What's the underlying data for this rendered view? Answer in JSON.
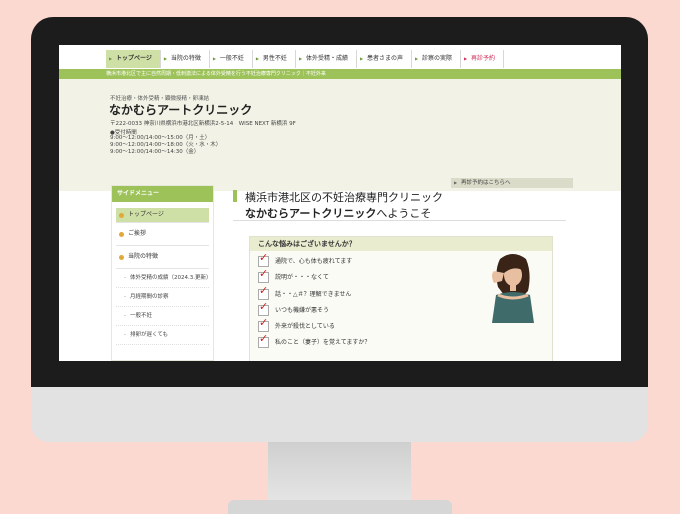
{
  "nav": {
    "items": [
      {
        "label": "トップページ"
      },
      {
        "label": "当院の特徴"
      },
      {
        "label": "一般不妊"
      },
      {
        "label": "男性不妊"
      },
      {
        "label": "体外受精・成績"
      },
      {
        "label": "患者さまの声"
      },
      {
        "label": "診察の実際"
      },
      {
        "label": "再診予約"
      }
    ]
  },
  "header": {
    "tagline": "横浜市港北区で主に自然周期・低刺激法による体外受精を行う不妊治療専門クリニック｜不妊外来",
    "services": "不妊治療・体外受精・顕微授精・卵凍結",
    "logo": "なかむらアートクリニック",
    "address": "〒222-0033 神奈川県横浜市港北区新横浜2-5-14　WISE NEXT 新横浜 9F",
    "hours_title": "●受付時間",
    "hours": [
      "9:00～12:00/14:00～15:00（月・土）",
      "9:00～12:00/14:00～18:00（火・水・木）",
      "9:00～12:00/14:00～14:30（金）"
    ],
    "web_button": "再診予約はこちらへ"
  },
  "sidebar": {
    "title": "サイドメニュー",
    "items": [
      {
        "label": "トップページ"
      },
      {
        "label": "ご挨拶"
      },
      {
        "label": "当院の特徴"
      }
    ],
    "subitems": [
      {
        "label": "体外受精の成績（2024.3.更新）"
      },
      {
        "label": "月経期間の診察"
      },
      {
        "label": "一般不妊"
      },
      {
        "label": "排卵が遅くても"
      }
    ]
  },
  "main": {
    "title1": "横浜市港北区の不妊治療専門クリニック",
    "title2_bold": "なかむらアートクリニック",
    "title2_rest": "へようこそ",
    "worry_title": "こんな悩みはございませんか？",
    "worries": [
      {
        "label": "通院で、心も体も疲れてます"
      },
      {
        "label": "説明が・・・なくて"
      },
      {
        "label": "話・・△＃？理解できません"
      },
      {
        "label": "いつも機嫌が悪そう"
      },
      {
        "label": "外来が殺伐としている"
      },
      {
        "label": "私のこと（妻子）を覚えてますか？"
      }
    ]
  },
  "colors": {
    "accent_green": "#9dc25a",
    "check_red": "#d21e1e",
    "background_pink": "#fbd9d1"
  }
}
